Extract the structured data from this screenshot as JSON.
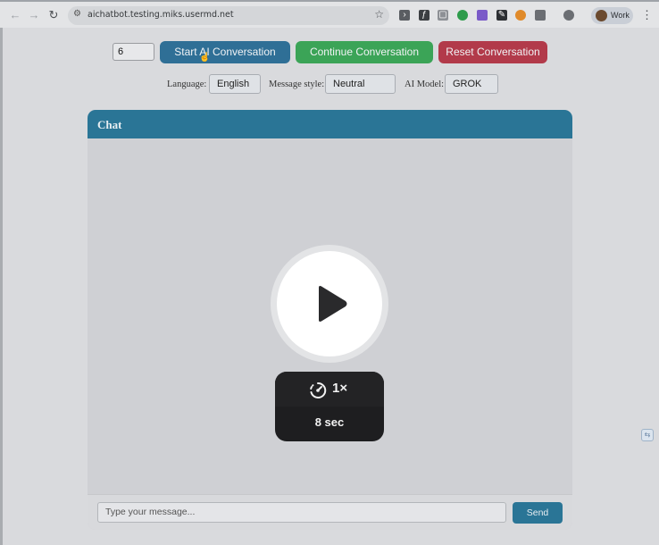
{
  "browser": {
    "url": "aichatbot.testing.miks.usermd.net",
    "profile_label": "Work"
  },
  "controls": {
    "count_value": "6",
    "start_label": "Start AI Conversation",
    "continue_label": "Continue Conversation",
    "reset_label": "Reset Conversation"
  },
  "options": {
    "language_label": "Language:",
    "language_value": "English",
    "style_label": "Message style:",
    "style_value": "Neutral",
    "model_label": "AI Model:",
    "model_value": "GROK"
  },
  "chat": {
    "title": "Chat",
    "input_placeholder": "Type your message...",
    "send_label": "Send"
  },
  "video_overlay": {
    "speed": "1×",
    "duration": "8 sec"
  },
  "colors": {
    "start": "#2f6f96",
    "continue": "#3ba457",
    "reset": "#b23a4a",
    "chat_header": "#2a7596"
  }
}
